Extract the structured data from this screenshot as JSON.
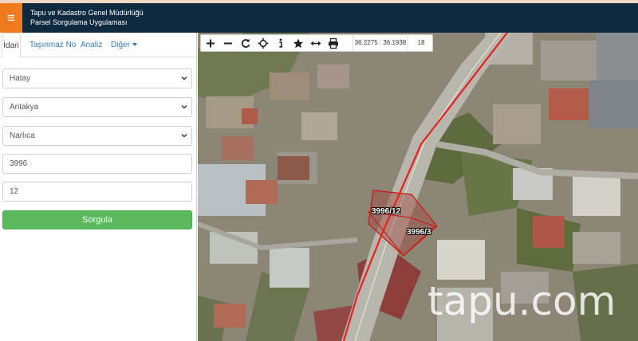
{
  "header": {
    "title_line1": "Tapu ve Kadastro Genel Müdürlüğü",
    "title_line2": "Parsel Sorgulama Uygulaması",
    "menu_icon": "hamburger-icon",
    "menu_glyph": "≡"
  },
  "tabs": [
    {
      "label": "İdari",
      "active": true
    },
    {
      "label": "Taşınmaz No",
      "active": false
    },
    {
      "label": "Analiz",
      "active": false
    },
    {
      "label": "Diğer",
      "active": false
    }
  ],
  "form": {
    "province": "Hatay",
    "district": "Antakya",
    "neighborhood": "Narlıca",
    "block": "3996",
    "parcel": "12",
    "query_button": "Sorgula"
  },
  "map": {
    "coordinates": "36.2275 : 36.1938",
    "zoom_level": "18",
    "parcels": [
      "3996/12",
      "3996/3"
    ],
    "watermark": "tapu.com",
    "boundary_color": "#e8201e"
  },
  "colors": {
    "header_bg": "#0f2a3e",
    "menu_accent": "#f07a1e",
    "query_button": "#5cb85c",
    "link": "#337ab7"
  }
}
